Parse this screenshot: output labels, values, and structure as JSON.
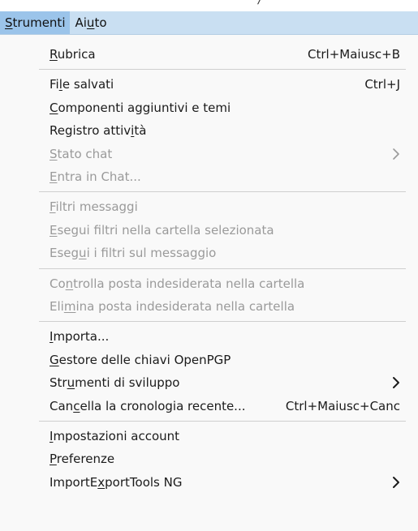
{
  "menubar": {
    "items": [
      {
        "label": "Strumenti",
        "accel": "S",
        "open": true
      },
      {
        "label": "Aiuto",
        "accel": "u",
        "open": false
      }
    ]
  },
  "menu": {
    "groups": [
      [
        {
          "label": "Rubrica",
          "accel_index": 0,
          "shortcut": "Ctrl+Maiusc+B",
          "enabled": true,
          "submenu": false
        }
      ],
      [
        {
          "label": "File salvati",
          "accel_index": 2,
          "shortcut": "Ctrl+J",
          "enabled": true,
          "submenu": false
        },
        {
          "label": "Componenti aggiuntivi e temi",
          "accel_index": 0,
          "shortcut": "",
          "enabled": true,
          "submenu": false
        },
        {
          "label": "Registro attività",
          "accel_index": 14,
          "shortcut": "",
          "enabled": true,
          "submenu": false
        },
        {
          "label": "Stato chat",
          "accel_index": 0,
          "shortcut": "",
          "enabled": false,
          "submenu": true
        },
        {
          "label": "Entra in Chat...",
          "accel_index": 0,
          "shortcut": "",
          "enabled": false,
          "submenu": false
        }
      ],
      [
        {
          "label": "Filtri messaggi",
          "accel_index": 0,
          "shortcut": "",
          "enabled": false,
          "submenu": false
        },
        {
          "label": "Esegui filtri nella cartella selezionata",
          "accel_index": 0,
          "shortcut": "",
          "enabled": false,
          "submenu": false
        },
        {
          "label": "Esegui i filtri sul messaggio",
          "accel_index": 4,
          "shortcut": "",
          "enabled": false,
          "submenu": false
        }
      ],
      [
        {
          "label": "Controlla posta indesiderata nella cartella",
          "accel_index": 2,
          "shortcut": "",
          "enabled": false,
          "submenu": false
        },
        {
          "label": "Elimina posta indesiderata nella cartella",
          "accel_index": 3,
          "shortcut": "",
          "enabled": false,
          "submenu": false
        }
      ],
      [
        {
          "label": "Importa...",
          "accel_index": 0,
          "shortcut": "",
          "enabled": true,
          "submenu": false
        },
        {
          "label": "Gestore delle chiavi OpenPGP",
          "accel_index": 0,
          "shortcut": "",
          "enabled": true,
          "submenu": false
        },
        {
          "label": "Strumenti di sviluppo",
          "accel_index": 3,
          "shortcut": "",
          "enabled": true,
          "submenu": true
        },
        {
          "label": "Cancella la cronologia recente...",
          "accel_index": 3,
          "shortcut": "Ctrl+Maiusc+Canc",
          "enabled": true,
          "submenu": false
        }
      ],
      [
        {
          "label": "Impostazioni account",
          "accel_index": 0,
          "shortcut": "",
          "enabled": true,
          "submenu": false
        },
        {
          "label": "Preferenze",
          "accel_index": 0,
          "shortcut": "",
          "enabled": true,
          "submenu": false
        },
        {
          "label": "ImportExportTools NG",
          "accel_index": 7,
          "shortcut": "",
          "enabled": true,
          "submenu": true
        }
      ]
    ]
  },
  "colors": {
    "menubar_bg": "#c9dff2",
    "menubar_open_bg": "#9bc4ea",
    "menu_bg": "#f9f9f9",
    "text": "#1b1b1b",
    "disabled_text": "#9a9a9a",
    "separator": "#cfcfcf"
  }
}
